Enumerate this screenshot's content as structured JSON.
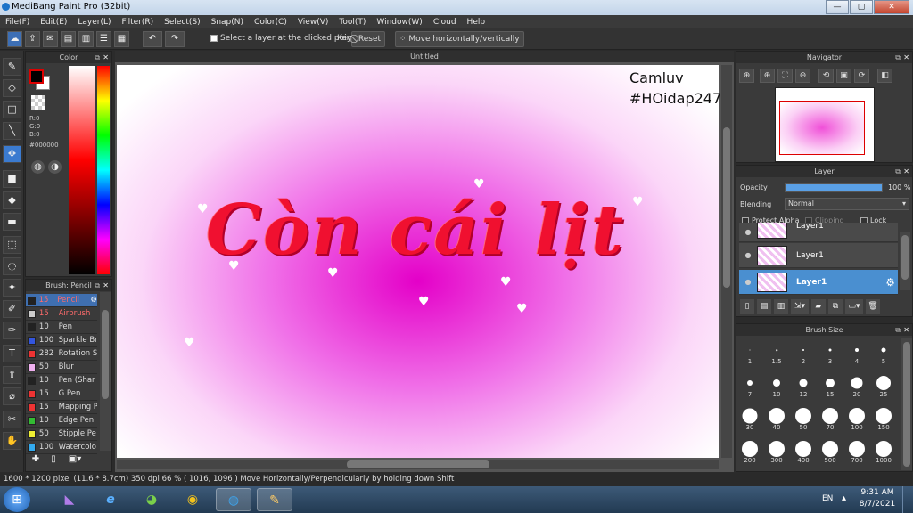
{
  "window": {
    "title": "MediBang Paint Pro (32bit)",
    "min": "—",
    "max": "▢",
    "close": "✕"
  },
  "menu": [
    "File(F)",
    "Edit(E)",
    "Layer(L)",
    "Filter(R)",
    "Select(S)",
    "Snap(N)",
    "Color(C)",
    "View(V)",
    "Tool(T)",
    "Window(W)",
    "Cloud",
    "Help"
  ],
  "toolbar": {
    "select_layer_label": "Select a layer at the clicked point",
    "key_label": "Key",
    "reset_label": "Reset",
    "move_label": "Move horizontally/vertically"
  },
  "color_panel": {
    "title": "Color",
    "r": "R:0",
    "g": "G:0",
    "b": "B:0",
    "hex": "#000000",
    "primary_color": "#000000"
  },
  "brush_panel": {
    "title": "Brush: Pencil",
    "items": [
      {
        "size": "15",
        "name": "Pencil",
        "color": "#222222"
      },
      {
        "size": "15",
        "name": "Airbrush",
        "color": "#cccccc"
      },
      {
        "size": "10",
        "name": "Pen",
        "color": "#222222"
      },
      {
        "size": "100",
        "name": "Sparkle Br",
        "color": "#3355dd"
      },
      {
        "size": "282",
        "name": "Rotation S",
        "color": "#ee3333"
      },
      {
        "size": "50",
        "name": "Blur",
        "color": "#f0b0f0"
      },
      {
        "size": "10",
        "name": "Pen (Shar",
        "color": "#222222"
      },
      {
        "size": "15",
        "name": "G Pen",
        "color": "#ee3333"
      },
      {
        "size": "15",
        "name": "Mapping P",
        "color": "#ee3333"
      },
      {
        "size": "10",
        "name": "Edge Pen",
        "color": "#33bb33"
      },
      {
        "size": "50",
        "name": "Stipple Pe",
        "color": "#eeee33"
      },
      {
        "size": "100",
        "name": "Watercolo",
        "color": "#33aaee"
      }
    ]
  },
  "document": {
    "tab_title": "Untitled",
    "watermark_line1": "Camluv",
    "watermark_line2": "#HOidap247",
    "artwork_text": "Còn cái lịt"
  },
  "navigator": {
    "title": "Navigator"
  },
  "layer_panel": {
    "title": "Layer",
    "opacity_label": "Opacity",
    "opacity_value": "100 %",
    "opacity": 1.0,
    "blending_label": "Blending",
    "blending_value": "Normal",
    "protect_alpha": "Protect Alpha",
    "clipping": "Clipping",
    "lock": "Lock",
    "layers": [
      "Layer1",
      "Layer1",
      "Layer1"
    ]
  },
  "brush_size_panel": {
    "title": "Brush Size",
    "sizes": [
      "1",
      "1.5",
      "2",
      "3",
      "4",
      "5",
      "7",
      "10",
      "12",
      "15",
      "20",
      "25",
      "30",
      "40",
      "50",
      "70",
      "100",
      "150",
      "200",
      "300",
      "400",
      "500",
      "700",
      "1000"
    ]
  },
  "status": {
    "dimensions": "1600 * 1200 pixel",
    "physical": "(11.6 * 8.7cm)",
    "dpi": "350 dpi",
    "zoom": "66 %",
    "coords": "( 1016, 1096 )",
    "message": "Move Horizontally/Perpendicularly by holding down Shift"
  },
  "taskbar": {
    "lang": "EN",
    "time": "9:31 AM",
    "date": "8/7/2021"
  }
}
